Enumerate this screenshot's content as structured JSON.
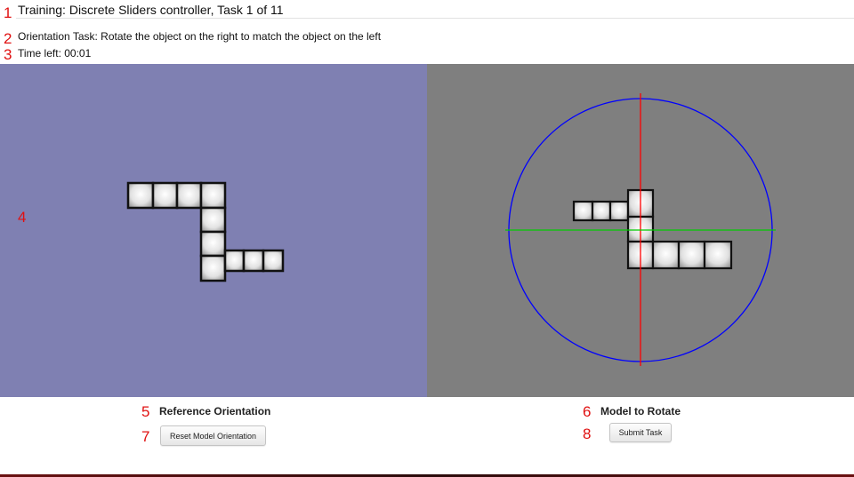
{
  "markers": [
    "1",
    "2",
    "3",
    "4",
    "5",
    "6",
    "7",
    "8"
  ],
  "header": {
    "title": "Training: Discrete Sliders controller, Task 1 of 11",
    "task_instruction": "Orientation Task: Rotate the object on the right to match the object on the left",
    "time_left": "Time left: 00:01"
  },
  "reference_pane": {
    "caption": "Reference Orientation",
    "background": "#7f80b2"
  },
  "model_pane": {
    "caption": "Model to Rotate",
    "background": "#7f7f7f",
    "gizmo": {
      "circle_color": "#0000ff",
      "vertical_axis_color": "#ff0000",
      "horizontal_axis_color": "#00cc00"
    }
  },
  "buttons": {
    "reset_label": "Reset Model Orientation",
    "submit_label": "Submit Task"
  }
}
